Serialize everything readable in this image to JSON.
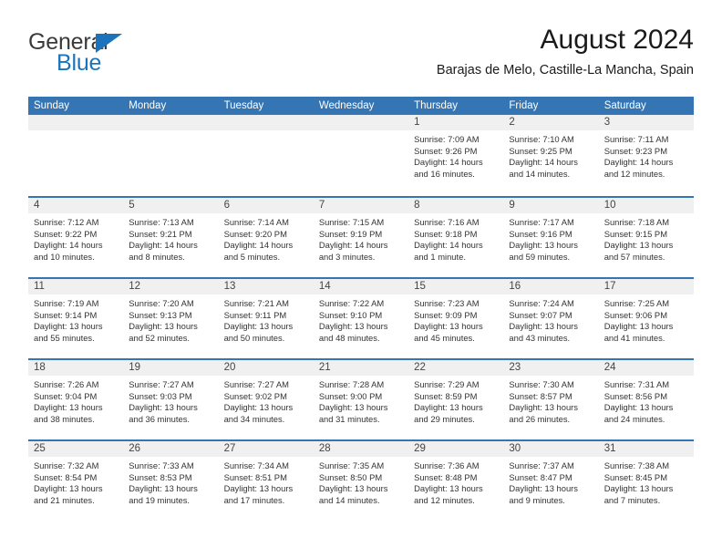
{
  "brand": {
    "name_top": "General",
    "name_bottom": "Blue",
    "color_blue": "#1b74bb",
    "color_dark": "#3a3a3a"
  },
  "header": {
    "title": "August 2024",
    "location": "Barajas de Melo, Castille-La Mancha, Spain"
  },
  "theme": {
    "header_blue": "#3575b4",
    "day_band_gray": "#f0f0f0",
    "text": "#333333"
  },
  "calendar": {
    "weekday_headers": [
      "Sunday",
      "Monday",
      "Tuesday",
      "Wednesday",
      "Thursday",
      "Friday",
      "Saturday"
    ],
    "weeks": [
      [
        {
          "day": "",
          "empty": true,
          "sunrise": "",
          "sunset": "",
          "daylight_1": "",
          "daylight_2": ""
        },
        {
          "day": "",
          "empty": true,
          "sunrise": "",
          "sunset": "",
          "daylight_1": "",
          "daylight_2": ""
        },
        {
          "day": "",
          "empty": true,
          "sunrise": "",
          "sunset": "",
          "daylight_1": "",
          "daylight_2": ""
        },
        {
          "day": "",
          "empty": true,
          "sunrise": "",
          "sunset": "",
          "daylight_1": "",
          "daylight_2": ""
        },
        {
          "day": "1",
          "empty": false,
          "sunrise": "Sunrise: 7:09 AM",
          "sunset": "Sunset: 9:26 PM",
          "daylight_1": "Daylight: 14 hours",
          "daylight_2": "and 16 minutes."
        },
        {
          "day": "2",
          "empty": false,
          "sunrise": "Sunrise: 7:10 AM",
          "sunset": "Sunset: 9:25 PM",
          "daylight_1": "Daylight: 14 hours",
          "daylight_2": "and 14 minutes."
        },
        {
          "day": "3",
          "empty": false,
          "sunrise": "Sunrise: 7:11 AM",
          "sunset": "Sunset: 9:23 PM",
          "daylight_1": "Daylight: 14 hours",
          "daylight_2": "and 12 minutes."
        }
      ],
      [
        {
          "day": "4",
          "empty": false,
          "sunrise": "Sunrise: 7:12 AM",
          "sunset": "Sunset: 9:22 PM",
          "daylight_1": "Daylight: 14 hours",
          "daylight_2": "and 10 minutes."
        },
        {
          "day": "5",
          "empty": false,
          "sunrise": "Sunrise: 7:13 AM",
          "sunset": "Sunset: 9:21 PM",
          "daylight_1": "Daylight: 14 hours",
          "daylight_2": "and 8 minutes."
        },
        {
          "day": "6",
          "empty": false,
          "sunrise": "Sunrise: 7:14 AM",
          "sunset": "Sunset: 9:20 PM",
          "daylight_1": "Daylight: 14 hours",
          "daylight_2": "and 5 minutes."
        },
        {
          "day": "7",
          "empty": false,
          "sunrise": "Sunrise: 7:15 AM",
          "sunset": "Sunset: 9:19 PM",
          "daylight_1": "Daylight: 14 hours",
          "daylight_2": "and 3 minutes."
        },
        {
          "day": "8",
          "empty": false,
          "sunrise": "Sunrise: 7:16 AM",
          "sunset": "Sunset: 9:18 PM",
          "daylight_1": "Daylight: 14 hours",
          "daylight_2": "and 1 minute."
        },
        {
          "day": "9",
          "empty": false,
          "sunrise": "Sunrise: 7:17 AM",
          "sunset": "Sunset: 9:16 PM",
          "daylight_1": "Daylight: 13 hours",
          "daylight_2": "and 59 minutes."
        },
        {
          "day": "10",
          "empty": false,
          "sunrise": "Sunrise: 7:18 AM",
          "sunset": "Sunset: 9:15 PM",
          "daylight_1": "Daylight: 13 hours",
          "daylight_2": "and 57 minutes."
        }
      ],
      [
        {
          "day": "11",
          "empty": false,
          "sunrise": "Sunrise: 7:19 AM",
          "sunset": "Sunset: 9:14 PM",
          "daylight_1": "Daylight: 13 hours",
          "daylight_2": "and 55 minutes."
        },
        {
          "day": "12",
          "empty": false,
          "sunrise": "Sunrise: 7:20 AM",
          "sunset": "Sunset: 9:13 PM",
          "daylight_1": "Daylight: 13 hours",
          "daylight_2": "and 52 minutes."
        },
        {
          "day": "13",
          "empty": false,
          "sunrise": "Sunrise: 7:21 AM",
          "sunset": "Sunset: 9:11 PM",
          "daylight_1": "Daylight: 13 hours",
          "daylight_2": "and 50 minutes."
        },
        {
          "day": "14",
          "empty": false,
          "sunrise": "Sunrise: 7:22 AM",
          "sunset": "Sunset: 9:10 PM",
          "daylight_1": "Daylight: 13 hours",
          "daylight_2": "and 48 minutes."
        },
        {
          "day": "15",
          "empty": false,
          "sunrise": "Sunrise: 7:23 AM",
          "sunset": "Sunset: 9:09 PM",
          "daylight_1": "Daylight: 13 hours",
          "daylight_2": "and 45 minutes."
        },
        {
          "day": "16",
          "empty": false,
          "sunrise": "Sunrise: 7:24 AM",
          "sunset": "Sunset: 9:07 PM",
          "daylight_1": "Daylight: 13 hours",
          "daylight_2": "and 43 minutes."
        },
        {
          "day": "17",
          "empty": false,
          "sunrise": "Sunrise: 7:25 AM",
          "sunset": "Sunset: 9:06 PM",
          "daylight_1": "Daylight: 13 hours",
          "daylight_2": "and 41 minutes."
        }
      ],
      [
        {
          "day": "18",
          "empty": false,
          "sunrise": "Sunrise: 7:26 AM",
          "sunset": "Sunset: 9:04 PM",
          "daylight_1": "Daylight: 13 hours",
          "daylight_2": "and 38 minutes."
        },
        {
          "day": "19",
          "empty": false,
          "sunrise": "Sunrise: 7:27 AM",
          "sunset": "Sunset: 9:03 PM",
          "daylight_1": "Daylight: 13 hours",
          "daylight_2": "and 36 minutes."
        },
        {
          "day": "20",
          "empty": false,
          "sunrise": "Sunrise: 7:27 AM",
          "sunset": "Sunset: 9:02 PM",
          "daylight_1": "Daylight: 13 hours",
          "daylight_2": "and 34 minutes."
        },
        {
          "day": "21",
          "empty": false,
          "sunrise": "Sunrise: 7:28 AM",
          "sunset": "Sunset: 9:00 PM",
          "daylight_1": "Daylight: 13 hours",
          "daylight_2": "and 31 minutes."
        },
        {
          "day": "22",
          "empty": false,
          "sunrise": "Sunrise: 7:29 AM",
          "sunset": "Sunset: 8:59 PM",
          "daylight_1": "Daylight: 13 hours",
          "daylight_2": "and 29 minutes."
        },
        {
          "day": "23",
          "empty": false,
          "sunrise": "Sunrise: 7:30 AM",
          "sunset": "Sunset: 8:57 PM",
          "daylight_1": "Daylight: 13 hours",
          "daylight_2": "and 26 minutes."
        },
        {
          "day": "24",
          "empty": false,
          "sunrise": "Sunrise: 7:31 AM",
          "sunset": "Sunset: 8:56 PM",
          "daylight_1": "Daylight: 13 hours",
          "daylight_2": "and 24 minutes."
        }
      ],
      [
        {
          "day": "25",
          "empty": false,
          "sunrise": "Sunrise: 7:32 AM",
          "sunset": "Sunset: 8:54 PM",
          "daylight_1": "Daylight: 13 hours",
          "daylight_2": "and 21 minutes."
        },
        {
          "day": "26",
          "empty": false,
          "sunrise": "Sunrise: 7:33 AM",
          "sunset": "Sunset: 8:53 PM",
          "daylight_1": "Daylight: 13 hours",
          "daylight_2": "and 19 minutes."
        },
        {
          "day": "27",
          "empty": false,
          "sunrise": "Sunrise: 7:34 AM",
          "sunset": "Sunset: 8:51 PM",
          "daylight_1": "Daylight: 13 hours",
          "daylight_2": "and 17 minutes."
        },
        {
          "day": "28",
          "empty": false,
          "sunrise": "Sunrise: 7:35 AM",
          "sunset": "Sunset: 8:50 PM",
          "daylight_1": "Daylight: 13 hours",
          "daylight_2": "and 14 minutes."
        },
        {
          "day": "29",
          "empty": false,
          "sunrise": "Sunrise: 7:36 AM",
          "sunset": "Sunset: 8:48 PM",
          "daylight_1": "Daylight: 13 hours",
          "daylight_2": "and 12 minutes."
        },
        {
          "day": "30",
          "empty": false,
          "sunrise": "Sunrise: 7:37 AM",
          "sunset": "Sunset: 8:47 PM",
          "daylight_1": "Daylight: 13 hours",
          "daylight_2": "and 9 minutes."
        },
        {
          "day": "31",
          "empty": false,
          "sunrise": "Sunrise: 7:38 AM",
          "sunset": "Sunset: 8:45 PM",
          "daylight_1": "Daylight: 13 hours",
          "daylight_2": "and 7 minutes."
        }
      ]
    ]
  }
}
